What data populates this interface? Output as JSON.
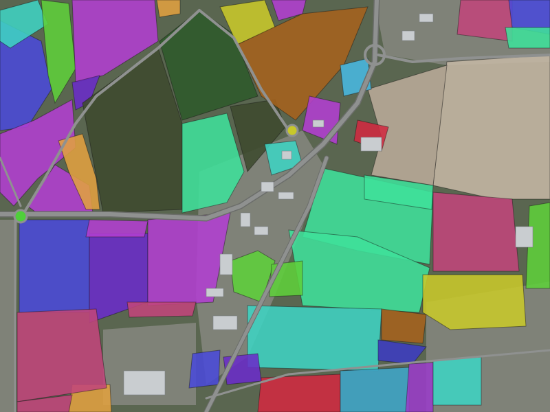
{
  "map": {
    "type": "aerial-segmentation",
    "palette": {
      "cyan": "#3fd3c2",
      "mint": "#3fe09a",
      "green_dark": "#2e5a2a",
      "olive_dark": "#3d4a2e",
      "magenta": "#b23fd0",
      "violet": "#6a2cc8",
      "blue": "#4a4ad8",
      "indigo": "#3c3cc0",
      "pink": "#c0467a",
      "orange": "#e0a040",
      "brown": "#a5621c",
      "yellow": "#c8c82a",
      "lime": "#5fcf3a",
      "red": "#d02a40",
      "steel": "#3fa6c8",
      "sky": "#48b8e0",
      "purple_alt": "#9a3cc8",
      "tan_field": "#c5b7a4",
      "bare_field": "#b9ab99",
      "road": "#8f9190"
    }
  }
}
